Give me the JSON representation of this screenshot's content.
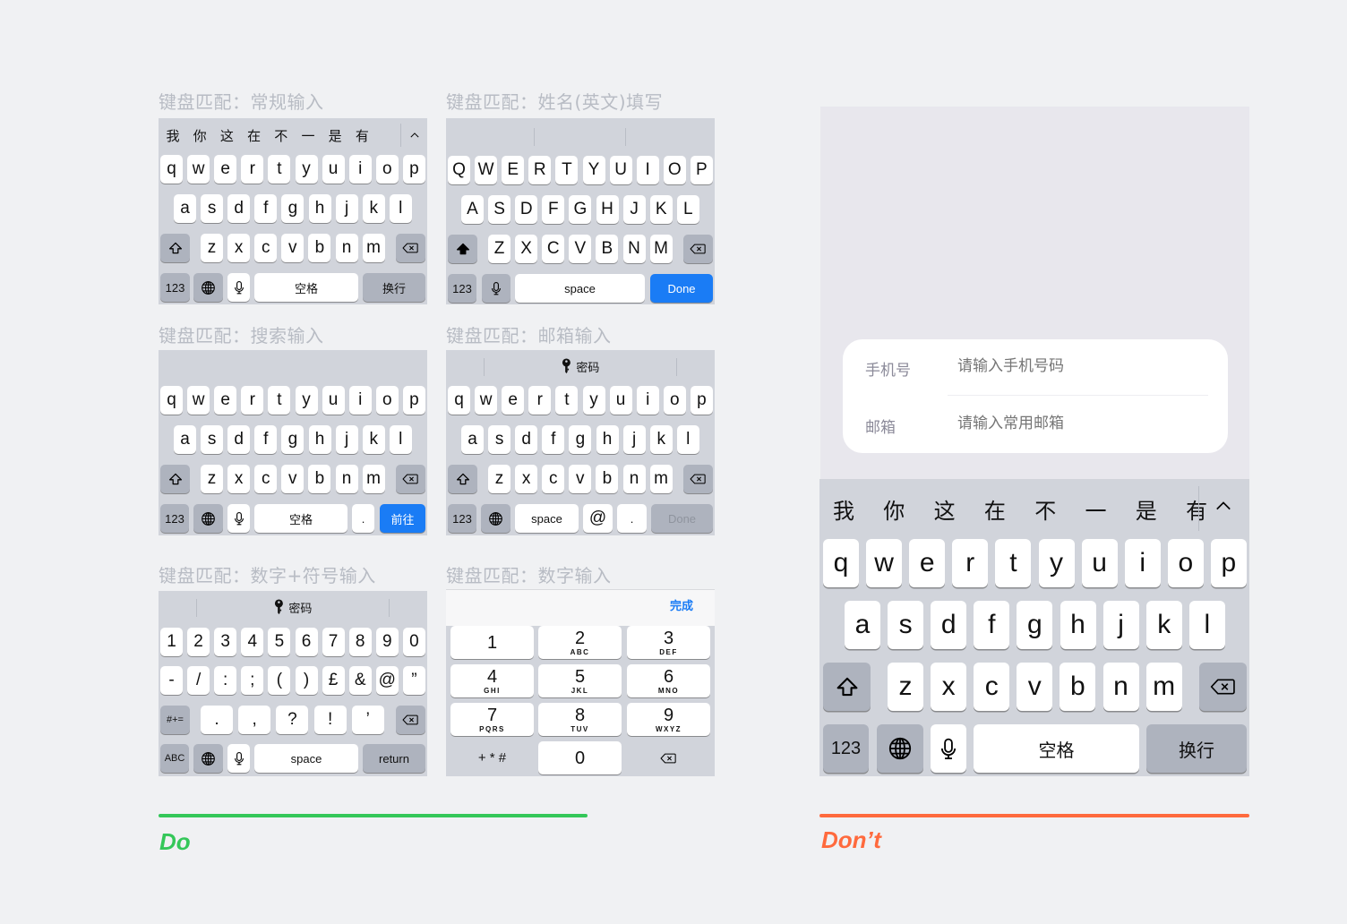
{
  "colors": {
    "page_bg": "#f0f1f3",
    "keyboard_bg": "#d1d4db",
    "key_bg": "#ffffff",
    "function_key_bg": "#aeb3be",
    "accent_blue": "#1a7cf5",
    "do_green": "#34c759",
    "dont_orange": "#ff6a3d",
    "caption_gray": "#b8bcc4"
  },
  "do_section": {
    "label": "Do",
    "keyboards": [
      {
        "caption": "键盘匹配：常规输入",
        "candidates": [
          "我",
          "你",
          "这",
          "在",
          "不",
          "一",
          "是",
          "有"
        ],
        "collapse_icon": "chevron-up-icon",
        "rows": [
          [
            "q",
            "w",
            "e",
            "r",
            "t",
            "y",
            "u",
            "i",
            "o",
            "p"
          ],
          [
            "a",
            "s",
            "d",
            "f",
            "g",
            "h",
            "j",
            "k",
            "l"
          ],
          [
            "z",
            "x",
            "c",
            "v",
            "b",
            "n",
            "m"
          ]
        ],
        "bottom": {
          "numbers": "123",
          "globe": "globe-icon",
          "mic": "mic-icon",
          "space": "空格",
          "action": "换行"
        }
      },
      {
        "caption": "键盘匹配：姓名(英文)填写",
        "rows": [
          [
            "Q",
            "W",
            "E",
            "R",
            "T",
            "Y",
            "U",
            "I",
            "O",
            "P"
          ],
          [
            "A",
            "S",
            "D",
            "F",
            "G",
            "H",
            "J",
            "K",
            "L"
          ],
          [
            "Z",
            "X",
            "C",
            "V",
            "B",
            "N",
            "M"
          ]
        ],
        "bottom": {
          "numbers": "123",
          "mic": "mic-icon",
          "space": "space",
          "action": "Done"
        }
      },
      {
        "caption": "键盘匹配：搜索输入",
        "rows": [
          [
            "q",
            "w",
            "e",
            "r",
            "t",
            "y",
            "u",
            "i",
            "o",
            "p"
          ],
          [
            "a",
            "s",
            "d",
            "f",
            "g",
            "h",
            "j",
            "k",
            "l"
          ],
          [
            "z",
            "x",
            "c",
            "v",
            "b",
            "n",
            "m"
          ]
        ],
        "bottom": {
          "numbers": "123",
          "globe": "globe-icon",
          "mic": "mic-icon",
          "space": "空格",
          "period": ".",
          "action": "前往"
        }
      },
      {
        "caption": "键盘匹配：邮箱输入",
        "password_suggestion": "密码",
        "rows": [
          [
            "q",
            "w",
            "e",
            "r",
            "t",
            "y",
            "u",
            "i",
            "o",
            "p"
          ],
          [
            "a",
            "s",
            "d",
            "f",
            "g",
            "h",
            "j",
            "k",
            "l"
          ],
          [
            "z",
            "x",
            "c",
            "v",
            "b",
            "n",
            "m"
          ]
        ],
        "bottom": {
          "numbers": "123",
          "globe": "globe-icon",
          "space": "space",
          "at": "@",
          "period": ".",
          "action": "Done"
        }
      },
      {
        "caption": "键盘匹配：数字+符号输入",
        "password_suggestion": "密码",
        "rows": [
          [
            "1",
            "2",
            "3",
            "4",
            "5",
            "6",
            "7",
            "8",
            "9",
            "0"
          ],
          [
            "-",
            "/",
            ":",
            ";",
            "(",
            ")",
            "£",
            "&",
            "@",
            "”"
          ],
          [
            ".",
            ",",
            "?",
            "!",
            "’"
          ]
        ],
        "bottom": {
          "symbols": "#+=",
          "letters": "ABC",
          "globe": "globe-icon",
          "mic": "mic-icon",
          "space": "space",
          "action": "return"
        }
      },
      {
        "caption": "键盘匹配：数字输入",
        "done": "完成",
        "keys": [
          {
            "n": "1",
            "l": ""
          },
          {
            "n": "2",
            "l": "ABC"
          },
          {
            "n": "3",
            "l": "DEF"
          },
          {
            "n": "4",
            "l": "GHI"
          },
          {
            "n": "5",
            "l": "JKL"
          },
          {
            "n": "6",
            "l": "MNO"
          },
          {
            "n": "7",
            "l": "PQRS"
          },
          {
            "n": "8",
            "l": "TUV"
          },
          {
            "n": "9",
            "l": "WXYZ"
          },
          {
            "n": "+ * #",
            "l": ""
          },
          {
            "n": "0",
            "l": ""
          },
          {
            "n": "delete-icon",
            "l": ""
          }
        ]
      }
    ]
  },
  "dont_section": {
    "label": "Don’t",
    "form": {
      "phone_label": "手机号",
      "phone_placeholder": "请输入手机号码",
      "email_label": "邮箱",
      "email_placeholder": "请输入常用邮箱"
    },
    "keyboard": {
      "candidates": [
        "我",
        "你",
        "这",
        "在",
        "不",
        "一",
        "是",
        "有"
      ],
      "rows": [
        [
          "q",
          "w",
          "e",
          "r",
          "t",
          "y",
          "u",
          "i",
          "o",
          "p"
        ],
        [
          "a",
          "s",
          "d",
          "f",
          "g",
          "h",
          "j",
          "k",
          "l"
        ],
        [
          "z",
          "x",
          "c",
          "v",
          "b",
          "n",
          "m"
        ]
      ],
      "bottom": {
        "numbers": "123",
        "space": "空格",
        "action": "换行"
      }
    }
  }
}
